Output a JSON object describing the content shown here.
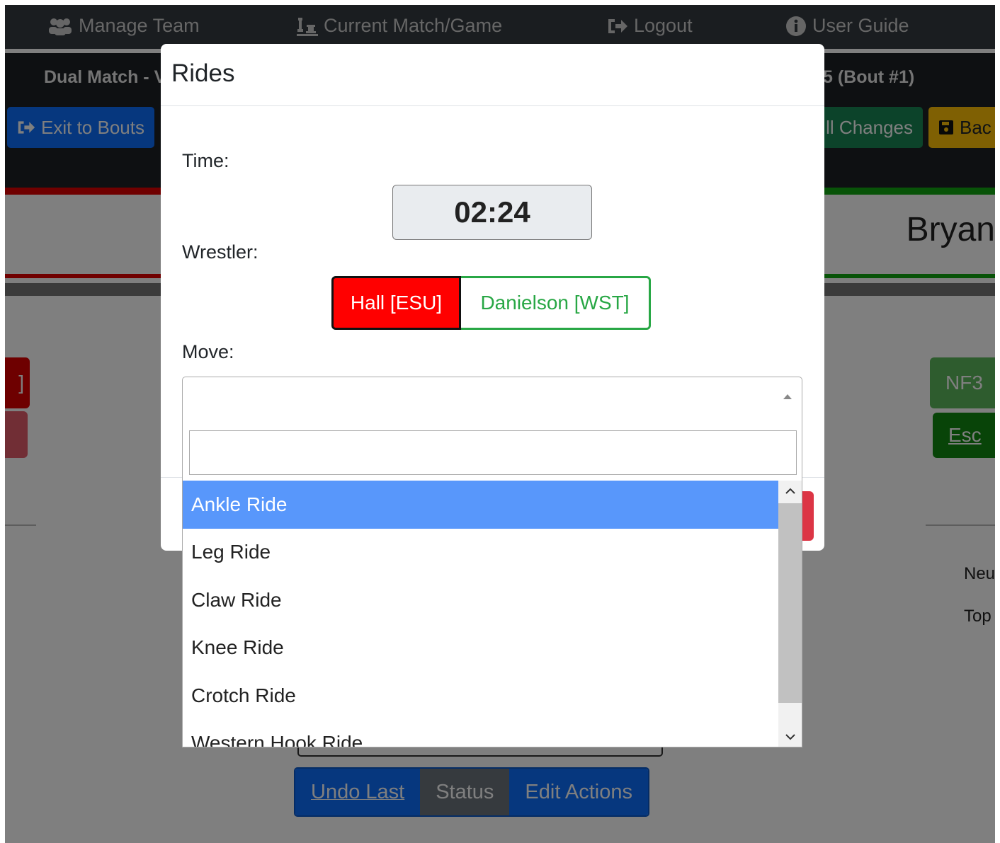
{
  "nav": {
    "manage_team": "Manage Team",
    "current_match": "Current Match/Game",
    "logout": "Logout",
    "user_guide": "User Guide"
  },
  "infobar": {
    "left_text": "Dual Match - V",
    "right_text": "5 (Bout #1)",
    "exit_button": "Exit to Bouts",
    "changes_button": "ll Changes",
    "back_button": "Bac"
  },
  "scoreboard": {
    "right_name": "Bryan",
    "right_btn_top": "NF3",
    "right_btn_bottom": "Esc",
    "left_btn_top": "]",
    "side_text_1": "Neu",
    "side_text_2": "Top"
  },
  "bottom_bar": {
    "undo_last": "Undo Last",
    "status": "Status",
    "edit_actions": "Edit Actions"
  },
  "modal": {
    "title": "Rides",
    "time_label": "Time:",
    "time_value": "02:24",
    "wrestler_label": "Wrestler:",
    "wrestler_red": "Hall [ESU]",
    "wrestler_green": "Danielson [WST]",
    "move_label": "Move:",
    "search_value": "",
    "options": [
      "Ankle Ride",
      "Leg Ride",
      "Claw Ride",
      "Knee Ride",
      "Crotch Ride",
      "Western Hook Ride"
    ],
    "selected_option": "Ankle Ride"
  },
  "colors": {
    "red_wrestler": "#ff0000",
    "green_wrestler": "#28a745",
    "highlight": "#5897fb"
  }
}
